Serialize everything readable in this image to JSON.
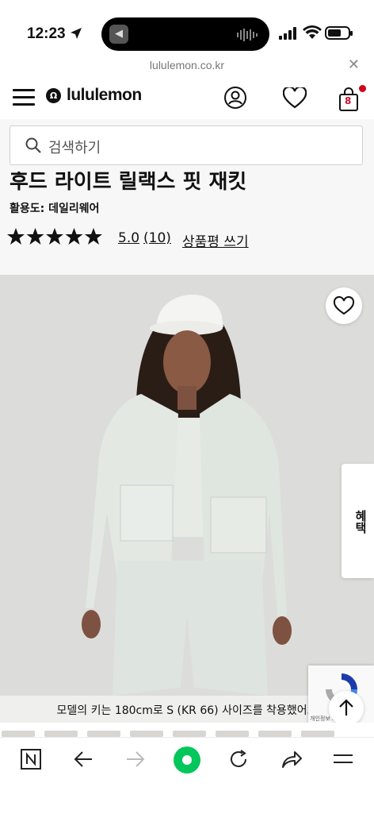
{
  "status_bar": {
    "time": "12:23"
  },
  "browser": {
    "url": "lululemon.co.kr"
  },
  "header": {
    "brand": "lululemon",
    "cart_count": "8"
  },
  "search": {
    "placeholder": "검색하기"
  },
  "product": {
    "title": "후드 라이트 릴랙스 핏 재킷",
    "activity": "활용도: 데일리웨어",
    "rating": "5.0",
    "review_count": "(10)",
    "write_review": "상품평 쓰기",
    "stars_filled": 5,
    "model_caption": "모델의 키는 180cm로 S (KR 66) 사이즈를 착용했어요"
  },
  "side_tab": {
    "label": "혜택"
  },
  "recaptcha": {
    "text": "개인정보 보호 · 약관"
  },
  "colors": {
    "accent": "#d0021b",
    "green": "#03c75a",
    "photo_bg": "#dcdcda"
  }
}
